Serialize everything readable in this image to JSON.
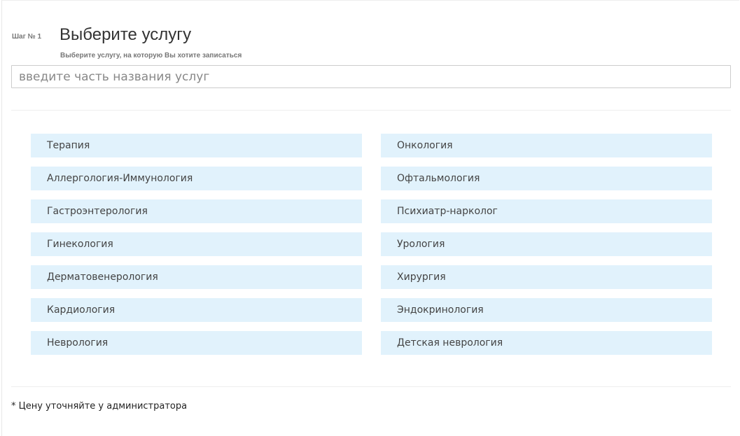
{
  "step": {
    "label": "Шаг № 1",
    "title": "Выберите услугу",
    "subtitle": "Выберите услугу, на которую Вы хотите записаться"
  },
  "search": {
    "placeholder": "введите часть названия услуг",
    "value": ""
  },
  "services": {
    "left": [
      "Терапия",
      "Аллергология-Иммунология",
      "Гастроэнтерология",
      "Гинекология",
      "Дерматовенерология",
      "Кардиология",
      "Неврология"
    ],
    "right": [
      "Онкология",
      "Офтальмология",
      "Психиатр-нарколог",
      "Урология",
      "Хирургия",
      "Эндокринология",
      "Детская неврология"
    ]
  },
  "footnote": "* Цену уточняйте у администратора",
  "colors": {
    "item_background": "#e1f2fc",
    "text": "#333333",
    "muted": "#777777"
  }
}
